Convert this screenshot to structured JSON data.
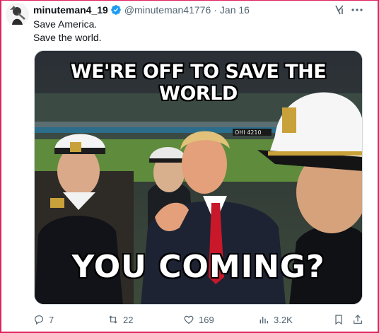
{
  "tweet": {
    "display_name": "minuteman4_19",
    "handle": "@minuteman41776",
    "separator": "·",
    "date": "Jan 16",
    "text_lines": [
      "Save America.",
      "Save the world."
    ],
    "verified_color": "#1d9bf0"
  },
  "media": {
    "meme_top": "WE'RE OFF TO SAVE THE WORLD",
    "meme_bottom": "YOU COMING?",
    "scoreboard_text": "OHI 4210"
  },
  "actions": {
    "replies": "7",
    "reposts": "22",
    "likes": "169",
    "views": "3.2K"
  },
  "icons": [
    "avatar",
    "verified-badge-icon",
    "grok-icon",
    "more-icon",
    "reply-icon",
    "repost-icon",
    "like-icon",
    "views-icon",
    "bookmark-icon",
    "share-icon"
  ],
  "colors": {
    "border": "#e0245e",
    "text": "#0f1419",
    "muted": "#536471"
  }
}
